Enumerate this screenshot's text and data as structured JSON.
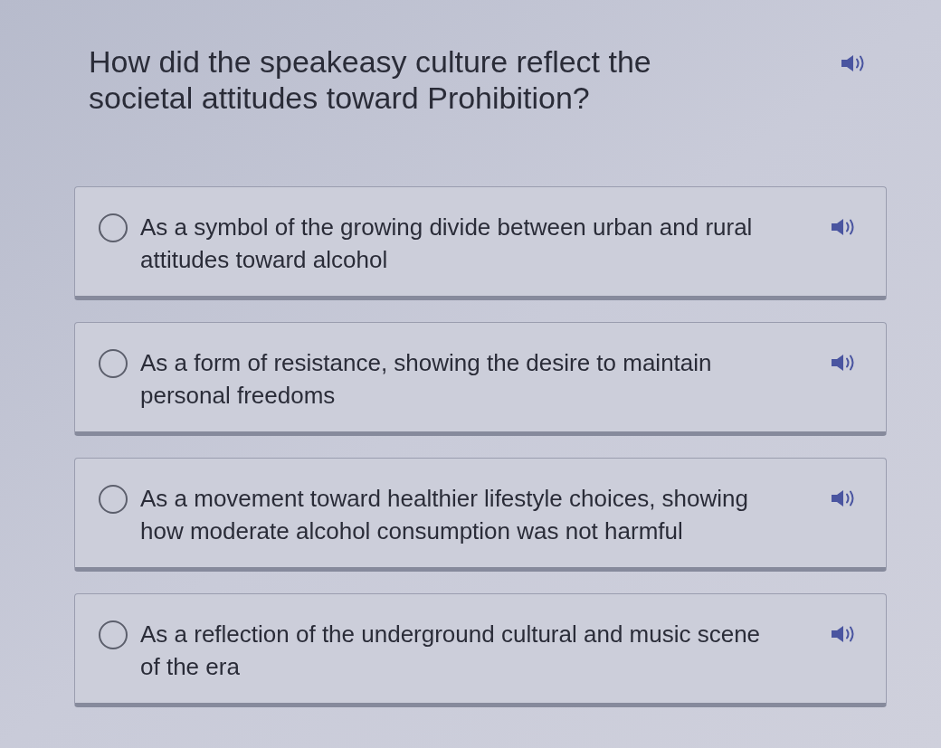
{
  "question": {
    "text": "How did the speakeasy culture reflect the societal attitudes toward Prohibition?"
  },
  "options": [
    {
      "text": "As a symbol of the growing divide between urban and rural attitudes toward alcohol",
      "selected": false
    },
    {
      "text": "As a form of resistance, showing the desire to maintain personal freedoms",
      "selected": false
    },
    {
      "text": "As a movement toward healthier lifestyle choices, showing how moderate alcohol consumption was not harmful",
      "selected": false
    },
    {
      "text": "As a reflection of the underground cultural and music scene of the era",
      "selected": false
    }
  ]
}
